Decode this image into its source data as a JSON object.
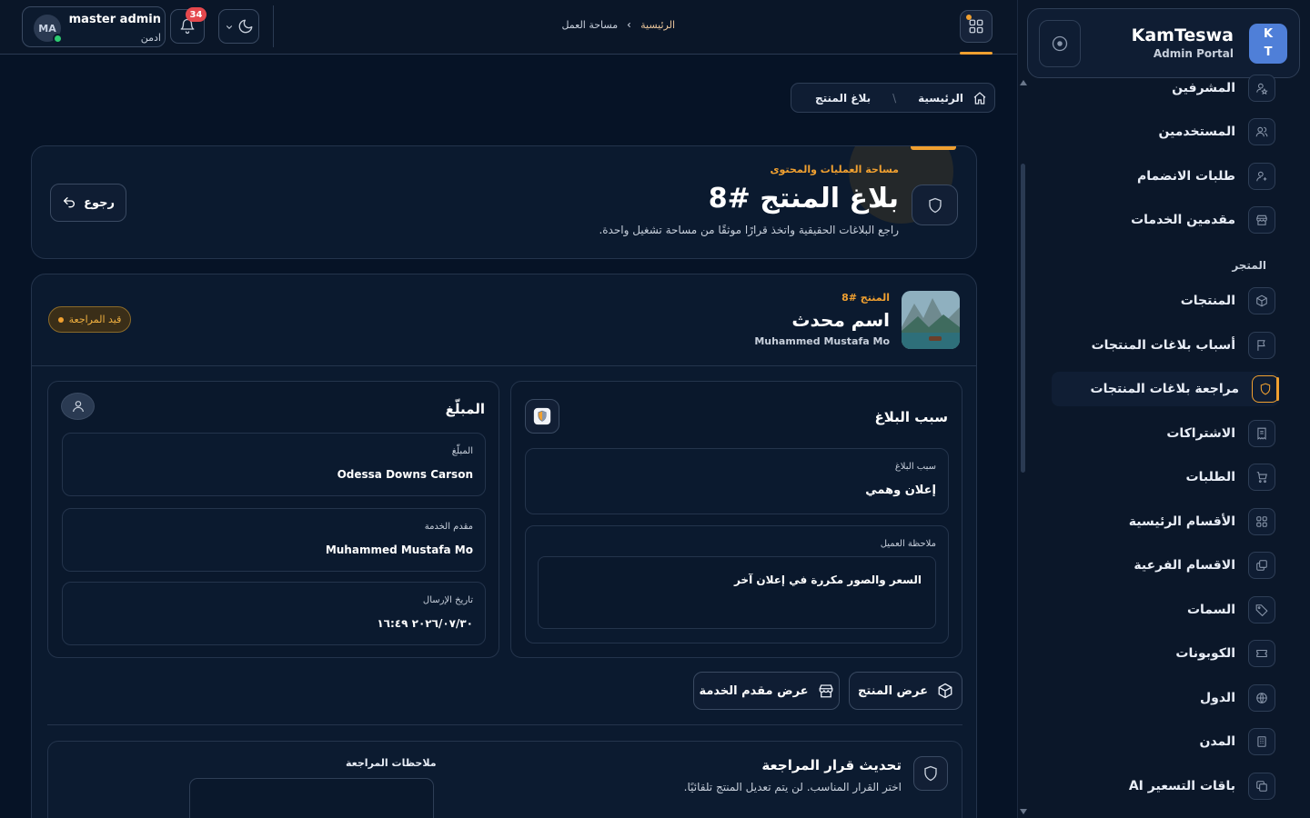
{
  "topbar": {
    "user_initials": "MA",
    "user_name": "master admin",
    "user_role": "ادمن",
    "notification_count": "34",
    "breadcrumb_home": "الرئيسية",
    "breadcrumb_current": "مساحة العمل"
  },
  "sidebar": {
    "brand_logo_line1": "K",
    "brand_logo_line2": "T",
    "brand_name": "KamTeswa",
    "brand_subtitle": "Admin Portal",
    "store_section_label": "المتجر",
    "items": [
      {
        "label": "المشرفين",
        "icon": "supervisor-icon"
      },
      {
        "label": "المستخدمين",
        "icon": "users-icon"
      },
      {
        "label": "طلبات الانضمام",
        "icon": "user-plus-icon"
      },
      {
        "label": "مقدمين الخدمات",
        "icon": "store-icon"
      },
      {
        "label": "المنتجات",
        "icon": "box-icon"
      },
      {
        "label": "أسباب بلاغات المنتجات",
        "icon": "flag-icon"
      },
      {
        "label": "مراجعة بلاغات المنتجات",
        "icon": "shield-icon",
        "active": true
      },
      {
        "label": "الاشتراكات",
        "icon": "receipt-icon"
      },
      {
        "label": "الطلبات",
        "icon": "cart-icon"
      },
      {
        "label": "الأقسام الرئيسية",
        "icon": "grid-icon"
      },
      {
        "label": "الاقسام الفرعية",
        "icon": "layers-icon"
      },
      {
        "label": "السمات",
        "icon": "tag-icon"
      },
      {
        "label": "الكوبونات",
        "icon": "ticket-icon"
      },
      {
        "label": "الدول",
        "icon": "globe-icon"
      },
      {
        "label": "المدن",
        "icon": "building-icon"
      },
      {
        "label": "باقات التسعير AI",
        "icon": "copy-icon"
      }
    ]
  },
  "page": {
    "breadcrumb_home": "الرئيسية",
    "breadcrumb_current": "بلاغ المنتج",
    "kicker": "مساحة العمليات والمحتوى",
    "title": "بلاغ المنتج #8",
    "subtitle": "راجع البلاغات الحقيقية واتخذ قرارًا موثقًا من مساحة تشغيل واحدة.",
    "back_label": "رجوع"
  },
  "product": {
    "kicker": "المنتج #8",
    "name": "اسم محدث",
    "owner": "Muhammed Mustafa Mo",
    "status": "قيد المراجعة",
    "status_color": "#f0a030"
  },
  "reason_card": {
    "title": "سبب البلاغ",
    "reason_label": "سبب البلاغ",
    "reason_value": "إعلان وهمي",
    "note_label": "ملاحظة العميل",
    "note_value": "السعر والصور مكررة في إعلان آخر"
  },
  "reporter_card": {
    "title": "المبلّغ",
    "reporter_label": "المبلّغ",
    "reporter_value": "Odessa Downs Carson",
    "provider_label": "مقدم الخدمة",
    "provider_value": "Muhammed Mustafa Mo",
    "date_label": "تاريخ الإرسال",
    "date_value": "٢٠٢٦/٠٧/٣٠ ١٦:٤٩"
  },
  "actions": {
    "view_product": "عرض المنتج",
    "view_provider": "عرض مقدم الخدمة"
  },
  "decision": {
    "title": "تحديث قرار المراجعة",
    "subtitle": "اختر القرار المناسب. لن يتم تعديل المنتج تلقائيًا.",
    "notes_label": "ملاحظات المراجعة",
    "notes_value": ""
  },
  "colors": {
    "accent": "#f0a030",
    "background": "#061326",
    "danger": "#e5484d",
    "online": "#2ecc71"
  }
}
